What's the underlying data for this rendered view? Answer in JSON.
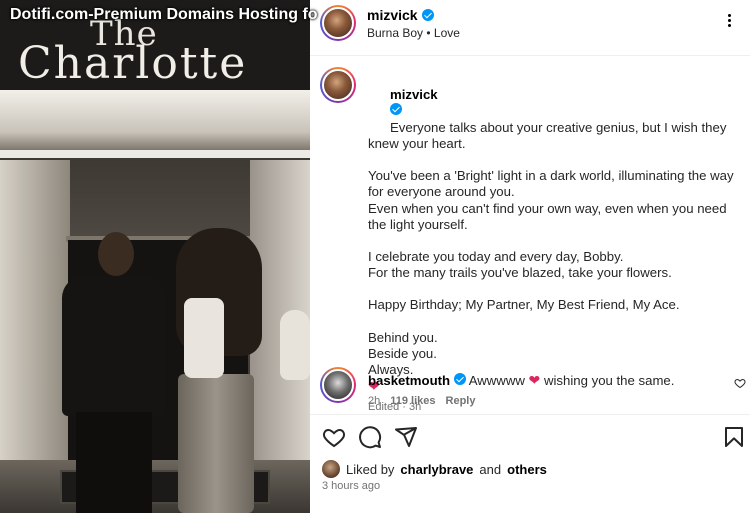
{
  "watermark": "Dotifi.com-Premium Domains Hosting fo",
  "photo": {
    "sign_line1": "The",
    "sign_line2": "Charlotte"
  },
  "post": {
    "header": {
      "username": "mizvick",
      "subtitle": "Burna Boy • Love"
    },
    "caption": {
      "username": "mizvick",
      "lines": [
        "Everyone talks about your creative genius, but I wish they knew your heart.",
        "You've been a 'Bright' light in a dark world, illuminating the way for everyone around you.",
        "Even when you can't find your own way, even when you need the light yourself.",
        "",
        "I celebrate you today and every day, Bobby.",
        "For the many trails you've blazed, take your flowers.",
        "",
        "Happy Birthday; My Partner, My Best Friend, My Ace.",
        "",
        "Behind you.",
        "Beside you.",
        "Always."
      ],
      "heart": "❤",
      "meta": "Edited · 3h"
    },
    "comment": {
      "username": "basketmouth",
      "text_before": "Awwwww",
      "heart": "❤",
      "text_after": "wishing you the same.",
      "time": "2h",
      "likes": "119 likes",
      "reply": "Reply"
    },
    "liked_by": {
      "prefix": "Liked by",
      "user": "charlybrave",
      "and": "and",
      "others": "others"
    },
    "timestamp": "3 hours ago"
  },
  "colors": {
    "verified": "#0095f6",
    "heart": "#e0245e",
    "muted": "#737373"
  },
  "icons": [
    "heart-outline-icon",
    "comment-icon",
    "share-icon",
    "bookmark-icon",
    "more-icon",
    "verified-icon"
  ]
}
